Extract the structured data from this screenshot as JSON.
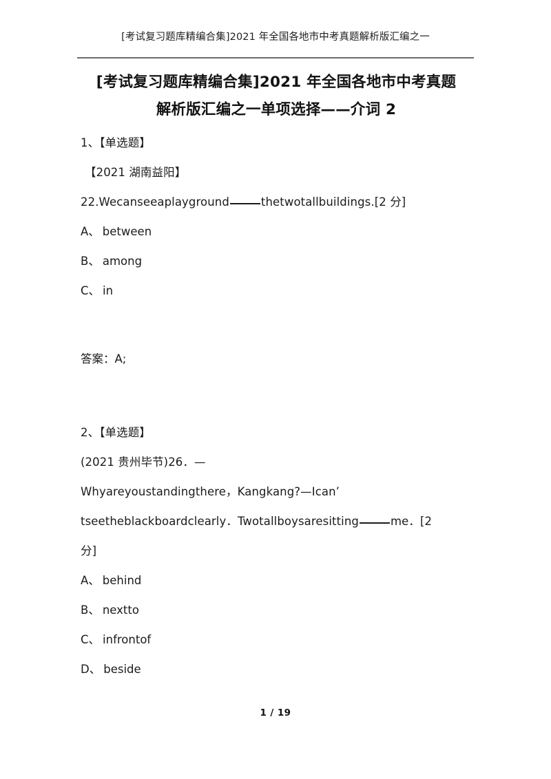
{
  "document": {
    "running_header": "[考试复习题库精编合集]2021 年全国各地市中考真题解析版汇编之一",
    "title_line_1": "[考试复习题库精编合集]2021 年全国各地市中考真题",
    "title_line_2": "解析版汇编之一单项选择——介词 2",
    "footer_page": "1 / 19",
    "text_color": "#1b1b1b",
    "rule_color": "#6b6b6b",
    "background": "#ffffff"
  },
  "questions": [
    {
      "number_label": "1、【单选题】",
      "source_label": "【2021 湖南益阳】",
      "stem_before_blank": "22.Wecanseeaplayground",
      "stem_after_blank": "thetwotallbuildings.[2 分]",
      "options": [
        {
          "key": "A、",
          "text": "between"
        },
        {
          "key": "B、",
          "text": "among"
        },
        {
          "key": "C、",
          "text": "in"
        }
      ],
      "answer": "答案：A;"
    },
    {
      "number_label": "2、【单选题】",
      "source_label": "(2021 贵州毕节)26．—",
      "stem_line_1": "Whyareyoustandingthere，Kangkang?—Ican’",
      "stem_line_2_before_blank": "tseetheblackboardclearly．Twotallboysaresitting",
      "stem_line_2_after_blank": "me．[2",
      "stem_line_3": "分]",
      "options": [
        {
          "key": "A、",
          "text": "behind"
        },
        {
          "key": "B、",
          "text": "nextto"
        },
        {
          "key": "C、",
          "text": "infrontof"
        },
        {
          "key": "D、",
          "text": "beside"
        }
      ]
    }
  ]
}
